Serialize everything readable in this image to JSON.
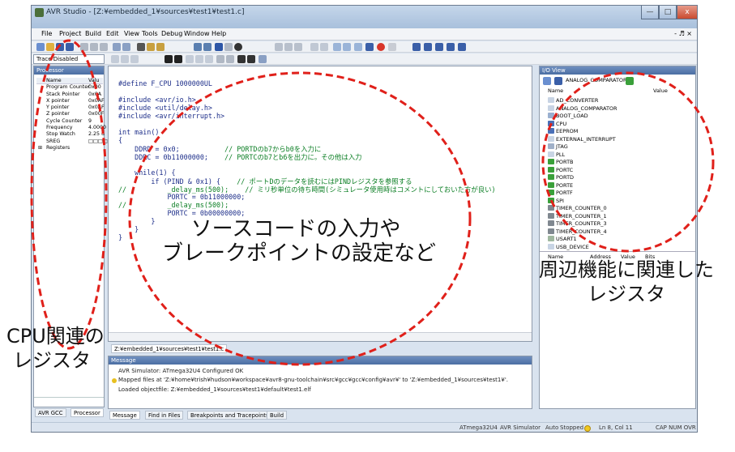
{
  "window": {
    "title": "AVR Studio - [Z:¥embedded_1¥sources¥test1¥test1.c]",
    "min": "—",
    "max": "□",
    "close": "x",
    "mdi_controls": "- ♬ ×"
  },
  "menu": [
    "File",
    "Project",
    "Build",
    "Edit",
    "View",
    "Tools",
    "Debug",
    "Window",
    "Help"
  ],
  "toolbar": {
    "trace_mode": "Trace Disabled"
  },
  "processor_panel": {
    "title": "Processor",
    "col_name": "Name",
    "col_value": "Valu",
    "rows": [
      {
        "name": "Program Counter",
        "value": "0x00"
      },
      {
        "name": "Stack Pointer",
        "value": "0x0A"
      },
      {
        "name": "X pointer",
        "value": "0x0AF"
      },
      {
        "name": "Y pointer",
        "value": "0x0AF"
      },
      {
        "name": "Z pointer",
        "value": "0x00F"
      },
      {
        "name": "Cycle Counter",
        "value": "9"
      },
      {
        "name": "Frequency",
        "value": "4.0000"
      },
      {
        "name": "Stop Watch",
        "value": "2.25 u"
      },
      {
        "name": "SREG",
        "value": "□□□□"
      },
      {
        "name": "Registers",
        "value": ""
      }
    ],
    "tabs": [
      "AVR GCC",
      "Processor"
    ]
  },
  "editor": {
    "file_tab": "Z:¥embedded_1¥sources¥test1¥test1.c",
    "lines": [
      {
        "code": "#define F_CPU 1000000UL",
        "comment": ""
      },
      {
        "code": "",
        "comment": ""
      },
      {
        "code": "#include <avr/io.h>",
        "comment": ""
      },
      {
        "code": "#include <util/delay.h>",
        "comment": ""
      },
      {
        "code": "#include <avr/interrupt.h>",
        "comment": ""
      },
      {
        "code": "",
        "comment": ""
      },
      {
        "code": "int main()",
        "comment": ""
      },
      {
        "code": "{",
        "comment": ""
      },
      {
        "code": "    DDRD = 0x0;",
        "comment": "           // PORTDのb7からb0を入力に"
      },
      {
        "code": "    DDRC = 0b11000000;",
        "comment": "    // PORTCのb7とb6を出力に。その他は入力"
      },
      {
        "code": "",
        "comment": ""
      },
      {
        "code": "    while(1) {",
        "comment": ""
      },
      {
        "code": "        if (PIND & 0x1) {",
        "comment": "    // ポートDのデータを読むにはPINDレジスタを参照する"
      },
      {
        "code": "//          _delay_ms(500);",
        "comment": "    // ミリ秒単位の待ち時間(シミュレータ使用時はコメントにしておいた方が良い)"
      },
      {
        "code": "            PORTC = 0b11000000;",
        "comment": ""
      },
      {
        "code": "//          _delay_ms(500);",
        "comment": ""
      },
      {
        "code": "            PORTC = 0b00000000;",
        "comment": ""
      },
      {
        "code": "        }",
        "comment": ""
      },
      {
        "code": "    }",
        "comment": ""
      },
      {
        "code": "}",
        "comment": ""
      }
    ]
  },
  "io_view": {
    "title": "I/O View",
    "device": "ANALOG_COMPARATOR",
    "col_name": "Name",
    "col_value": "Value",
    "items": [
      "AD_CONVERTER",
      "ANALOG_COMPARATOR",
      "BOOT_LOAD",
      "CPU",
      "EEPROM",
      "EXTERNAL_INTERRUPT",
      "JTAG",
      "PLL",
      "PORTB",
      "PORTC",
      "PORTD",
      "PORTE",
      "PORTF",
      "SPI",
      "TIMER_COUNTER_0",
      "TIMER_COUNTER_1",
      "TIMER_COUNTER_3",
      "TIMER_COUNTER_4",
      "USART1",
      "USB_DEVICE"
    ],
    "details_cols": [
      "Name",
      "Address",
      "Value",
      "Bits"
    ]
  },
  "message_panel": {
    "title": "Message",
    "lines": [
      "AVR Simulator: ATmega32U4 Configured OK",
      "Mapped files at 'Z:¥home¥trish¥hudson¥workspace¥avr8-gnu-toolchain¥src¥gcc¥gcc¥config¥avr¥' to 'Z:¥embedded_1¥sources¥test1¥'.",
      "Loaded objectfile: Z:¥embedded_1¥sources¥test1¥default¥test1.elf"
    ],
    "tabs": [
      "Message",
      "Find in Files",
      "Breakpoints and Tracepoints",
      "Build"
    ]
  },
  "statusbar": {
    "device": "ATmega32U4",
    "tool": "AVR Simulator",
    "mode": "Auto",
    "state": "Stopped",
    "position": "Ln 8, Col 11",
    "keys": "CAP  NUM  OVR"
  },
  "annotations": {
    "editor_line1": "ソースコードの入力や",
    "editor_line2": "ブレークポイントの設定など",
    "cpu_line1": "CPU関連の",
    "cpu_line2": "レジスタ",
    "periph_line1": "周辺機能に関連した",
    "periph_line2": "レジスタ"
  },
  "colors": {
    "annotation_red": "#e0201a",
    "title_gradient": "#a9c0dc",
    "panel_head": "#4b6ea3",
    "code_blue": "#1e2f8a",
    "comment_green": "#0a7e23"
  }
}
